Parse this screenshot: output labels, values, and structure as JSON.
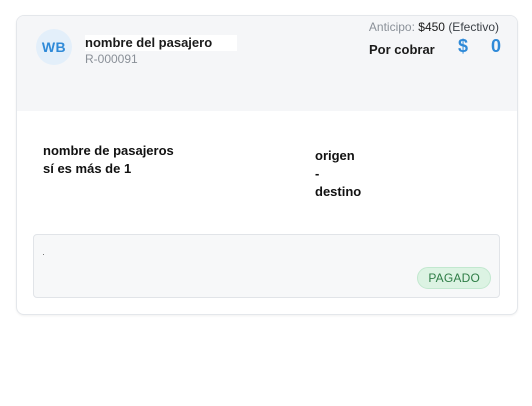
{
  "passenger": {
    "initials": "WB",
    "name": "nombre del pasajero",
    "reservation_code": "R-000091"
  },
  "payment": {
    "anticipo_label": "Anticipo:",
    "anticipo_amount": "$450",
    "anticipo_method": "(Efectivo)",
    "por_cobrar_label": "Por cobrar",
    "currency_symbol": "$",
    "balance": "0"
  },
  "details": {
    "passengers_line1": "nombre de pasajeros",
    "passengers_line2": "sí es más de 1",
    "origin": "origen",
    "separator": "-",
    "destination": "destino"
  },
  "status": {
    "label": "PAGADO",
    "color": "#2e7d46",
    "background": "#dcf3e3"
  },
  "colors": {
    "accent": "#2f8ad8",
    "header_bg": "#f5f6f8"
  }
}
